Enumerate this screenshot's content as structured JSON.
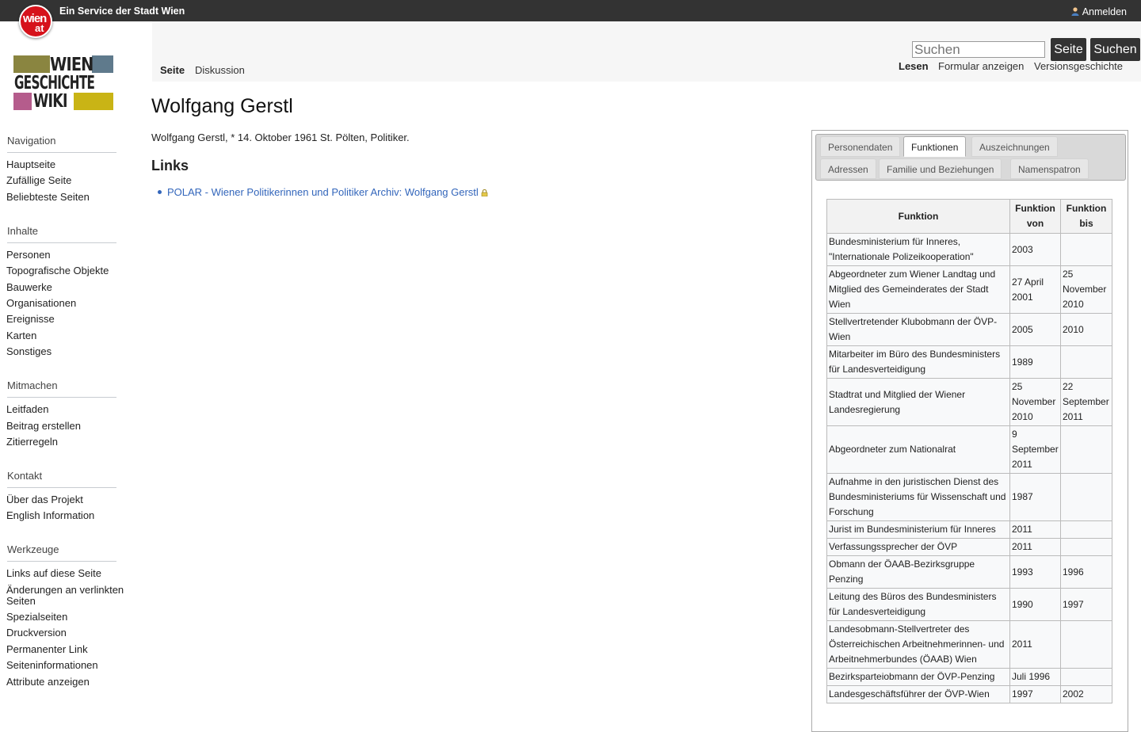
{
  "topbar": {
    "logo_line1": "wien",
    "logo_line2": "at",
    "service_text": "Ein Service der Stadt Wien",
    "login_label": "Anmelden"
  },
  "wiki_logo": {
    "line1": "WIEN",
    "line2": "GESCHICHTE",
    "line3": "WIKI",
    "colors": [
      "#8a8540",
      "#5f7a8c",
      "#b55c8c",
      "#c9b415"
    ]
  },
  "sidebar": {
    "sections": [
      {
        "title": "Navigation",
        "items": [
          "Hauptseite",
          "Zufällige Seite",
          "Beliebteste Seiten"
        ]
      },
      {
        "title": "Inhalte",
        "items": [
          "Personen",
          "Topografische Objekte",
          "Bauwerke",
          "Organisationen",
          "Ereignisse",
          "Karten",
          "Sonstiges"
        ]
      },
      {
        "title": "Mitmachen",
        "items": [
          "Leitfaden",
          "Beitrag erstellen",
          "Zitierregeln"
        ]
      },
      {
        "title": "Kontakt",
        "items": [
          "Über das Projekt",
          "English Information"
        ]
      },
      {
        "title": "Werkzeuge",
        "items": [
          "Links auf diese Seite",
          "Änderungen an verlinkten Seiten",
          "Spezialseiten",
          "Druckversion",
          "Permanenter Link",
          "Seiteninformationen",
          "Attribute anzeigen"
        ]
      }
    ]
  },
  "header": {
    "tab_page": "Seite",
    "tab_discussion": "Diskussion",
    "search_placeholder": "Suchen",
    "search_page_button": "Seite",
    "search_button": "Suchen",
    "view_read": "Lesen",
    "view_form": "Formular anzeigen",
    "view_history": "Versionsgeschichte"
  },
  "content": {
    "title": "Wolfgang Gerstl",
    "intro": "Wolfgang Gerstl, * 14. Oktober 1961 St. Pölten, Politiker.",
    "links_heading": "Links",
    "link_text": "POLAR - Wiener Politikerinnen und Politiker Archiv: Wolfgang Gerstl"
  },
  "infobox": {
    "tabs_row1": [
      "Personendaten",
      "Funktionen",
      "Auszeichnungen"
    ],
    "tabs_row2": [
      "Adressen",
      "Familie und Beziehungen",
      "Namenspatron"
    ],
    "active_tab": "Funktionen",
    "columns": [
      "Funktion",
      "Funktion von",
      "Funktion bis"
    ],
    "rows": [
      [
        "Bundesministerium für Inneres, \"Internationale Polizeikooperation\"",
        "2003",
        ""
      ],
      [
        "Abgeordneter zum Wiener Landtag und Mitglied des Gemeinderates der Stadt Wien",
        "27 April 2001",
        "25 November 2010"
      ],
      [
        "Stellvertretender Klubobmann der ÖVP-Wien",
        "2005",
        "2010"
      ],
      [
        "Mitarbeiter im Büro des Bundesministers für Landesverteidigung",
        "1989",
        ""
      ],
      [
        "Stadtrat und Mitglied der Wiener Landesregierung",
        "25 November 2010",
        "22 September 2011"
      ],
      [
        "Abgeordneter zum Nationalrat",
        "9 September 2011",
        ""
      ],
      [
        "Aufnahme in den juristischen Dienst des Bundesministeriums für Wissenschaft und Forschung",
        "1987",
        ""
      ],
      [
        "Jurist im Bundesministerium für Inneres",
        "2011",
        ""
      ],
      [
        "Verfassungssprecher der ÖVP",
        "2011",
        ""
      ],
      [
        "Obmann der ÖAAB-Bezirksgruppe Penzing",
        "1993",
        "1996"
      ],
      [
        "Leitung des Büros des Bundesministers für Landesverteidigung",
        "1990",
        "1997"
      ],
      [
        "Landesobmann-Stellvertreter des Österreichischen Arbeitnehmerinnen- und Arbeitnehmerbundes (ÖAAB) Wien",
        "2011",
        ""
      ],
      [
        "Bezirksparteiobmann der ÖVP-Penzing",
        "Juli 1996",
        ""
      ],
      [
        "Landesgeschäftsführer der ÖVP-Wien",
        "1997",
        "2002"
      ]
    ]
  },
  "colors": {
    "topbar": "#333333",
    "link": "#3366bb",
    "wien_red": "#d6121b"
  }
}
